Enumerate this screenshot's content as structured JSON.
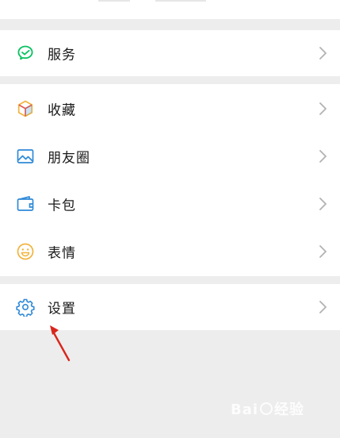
{
  "menu": {
    "service": {
      "label": "服务",
      "icon": "wechat-pay-icon"
    },
    "favorites": {
      "label": "收藏",
      "icon": "cube-icon"
    },
    "moments": {
      "label": "朋友圈",
      "icon": "image-icon"
    },
    "cards": {
      "label": "卡包",
      "icon": "wallet-icon"
    },
    "stickers": {
      "label": "表情",
      "icon": "smiley-icon"
    },
    "settings": {
      "label": "设置",
      "icon": "gear-icon"
    }
  },
  "colors": {
    "accent_green": "#07c160",
    "icon_blue": "#2f8ad8",
    "icon_yellow": "#f2b33d",
    "annotation_red": "#d9261c",
    "background": "#ededed"
  }
}
